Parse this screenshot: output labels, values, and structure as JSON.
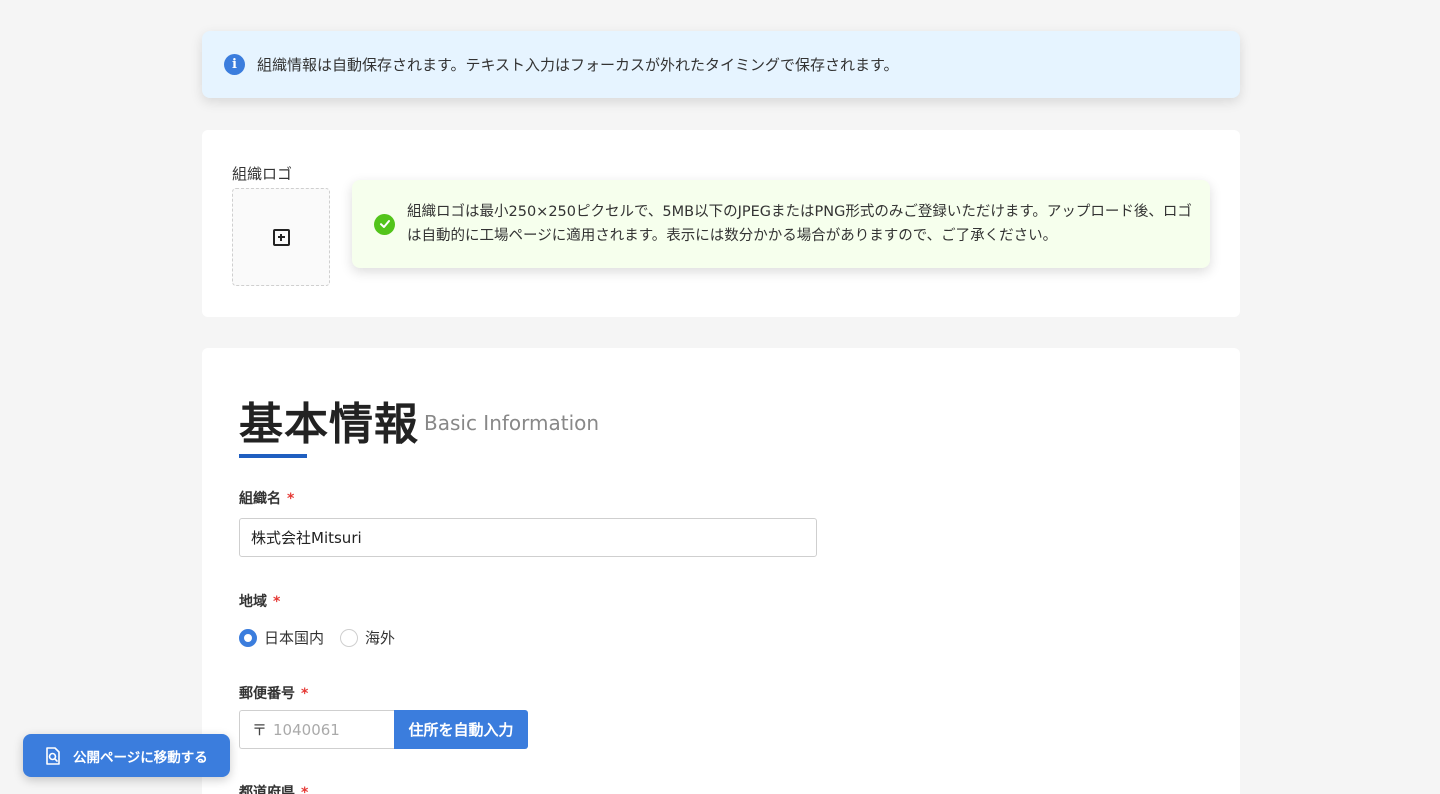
{
  "info_alert": {
    "icon": "info-icon",
    "text": "組織情報は自動保存されます。テキスト入力はフォーカスが外れたタイミングで保存されます。"
  },
  "logo_section": {
    "label": "組織ロゴ",
    "upload_icon": "plus-square-icon",
    "notice": {
      "icon": "check-circle-icon",
      "text": "組織ロゴは最小250×250ピクセルで、5MB以下のJPEGまたはPNG形式のみご登録いただけます。アップロード後、ロゴは自動的に工場ページに適用されます。表示には数分かかる場合がありますので、ご了承ください。"
    }
  },
  "basic_info": {
    "title": "基本情報",
    "subtitle": "Basic Information",
    "org_name": {
      "label": "組織名",
      "required_mark": "*",
      "value": "株式会社Mitsuri"
    },
    "region": {
      "label": "地域",
      "required_mark": "*",
      "options": [
        "日本国内",
        "海外"
      ],
      "selected": "日本国内"
    },
    "postal_code": {
      "label": "郵便番号",
      "required_mark": "*",
      "prefix": "〒",
      "placeholder": "1040061",
      "button_label": "住所を自動入力"
    },
    "prefecture": {
      "label": "都道府県",
      "required_mark": "*"
    }
  },
  "floating_button": {
    "icon": "page-search-icon",
    "label": "公開ページに移動する"
  },
  "colors": {
    "accent": "#3b7ddd",
    "info_bg": "#e6f4ff",
    "success_bg": "#f6ffed",
    "success_icon": "#52c41a",
    "required": "#e53935",
    "title_underline": "#1f5fc0"
  }
}
